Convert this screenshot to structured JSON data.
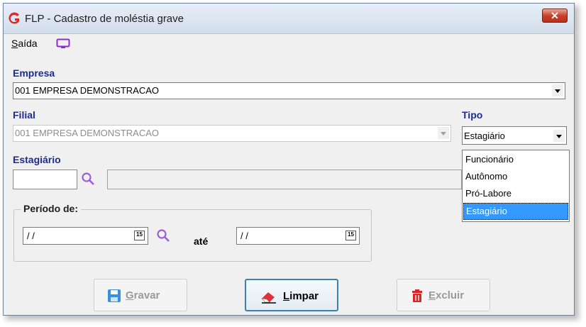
{
  "window": {
    "title": "FLP - Cadastro de moléstia grave",
    "close_glyph": "✕"
  },
  "menu": {
    "saida_label": "Saída",
    "saida_underline": "S",
    "saida_rest": "aída"
  },
  "empresa": {
    "label": "Empresa",
    "value": "001 EMPRESA DEMONSTRACAO"
  },
  "filial": {
    "label": "Filial",
    "value": "001 EMPRESA DEMONSTRACAO"
  },
  "tipo": {
    "label": "Tipo",
    "value": "Estagiário",
    "options": [
      "Funcionário",
      "Autônomo",
      "Pró-Labore",
      "Estagiário"
    ],
    "selected_index": 3
  },
  "estagiario": {
    "label": "Estagiário",
    "code_value": "",
    "name_value": ""
  },
  "periodo": {
    "label": "Período de:",
    "from_value": " / /",
    "to_label": "até",
    "to_value": " / /",
    "calendar_glyph": "15"
  },
  "buttons": {
    "gravar": {
      "label_underline": "G",
      "label_rest": "ravar",
      "enabled": false
    },
    "limpar": {
      "label_underline": "L",
      "label_rest": "impar",
      "enabled": true
    },
    "excluir": {
      "label_underline": "E",
      "label_rest": "xcluir",
      "enabled": false
    }
  },
  "colors": {
    "label_blue": "#1b2d8f",
    "selection": "#3399ff",
    "logo_red": "#d22d2d",
    "monitor_purple": "#8b2bd6",
    "search_purple": "#9b5fd6"
  },
  "icons": {
    "app": "flp-logo-icon",
    "saida": "monitor-icon",
    "search": "search-icon",
    "calendar": "calendar-icon",
    "gravar": "save-icon",
    "limpar": "eraser-icon",
    "excluir": "trash-icon"
  }
}
